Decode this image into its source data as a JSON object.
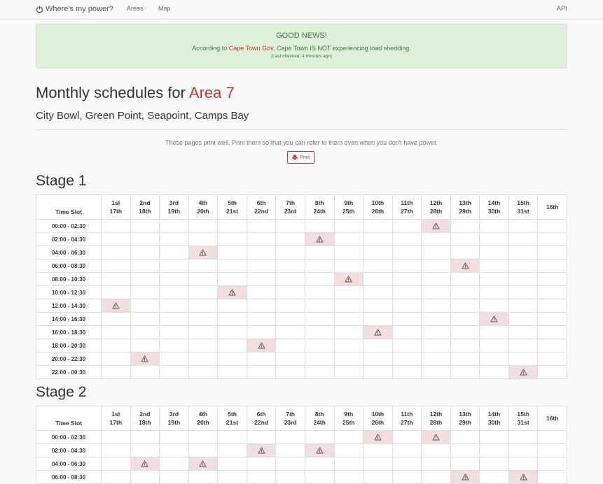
{
  "nav": {
    "brand": "Where's my power?",
    "links": [
      "Areas",
      "Map"
    ],
    "api": "API"
  },
  "alert": {
    "title": "GOOD NEWS!",
    "prefix": "According to ",
    "source": "Cape Town Gov",
    "suffix": ", Cape Town IS NOT experiencing load shedding.",
    "checked": "(Last checked: 4 minutes ago)"
  },
  "page": {
    "title_prefix": "Monthly schedules for ",
    "area": "Area 7",
    "subtitle": "City Bowl, Green Point, Seapoint, Camps Bay",
    "print_note": "These pages print well. Print them so that you can refer to them even when you don't have power.",
    "print_label": "Print"
  },
  "table": {
    "time_slot_header": "Time Slot",
    "day_headers": [
      [
        "1st",
        "17th"
      ],
      [
        "2nd",
        "18th"
      ],
      [
        "3rd",
        "19th"
      ],
      [
        "4th",
        "20th"
      ],
      [
        "5th",
        "21st"
      ],
      [
        "6th",
        "22nd"
      ],
      [
        "7th",
        "23rd"
      ],
      [
        "8th",
        "24th"
      ],
      [
        "9th",
        "25th"
      ],
      [
        "10th",
        "26th"
      ],
      [
        "11th",
        "27th"
      ],
      [
        "12th",
        "28th"
      ],
      [
        "13th",
        "29th"
      ],
      [
        "14th",
        "30th"
      ],
      [
        "15th",
        "31st"
      ],
      [
        "16th",
        ""
      ]
    ],
    "slots": [
      "00:00 - 02:30",
      "02:00 - 04:30",
      "04:00 - 06:30",
      "06:00 - 08:30",
      "08:00 - 10:30",
      "10:00 - 12:30",
      "12:00 - 14:30",
      "14:00 - 16:30",
      "16:00 - 18:30",
      "18:00 - 20:30",
      "20:00 - 22:30",
      "22:00 - 00:30"
    ]
  },
  "stages": [
    {
      "title": "Stage 1",
      "visible_rows": 12,
      "shedding": [
        [
          11
        ],
        [
          7
        ],
        [
          3
        ],
        [
          12
        ],
        [
          8
        ],
        [
          4
        ],
        [
          0
        ],
        [
          13
        ],
        [
          9
        ],
        [
          5
        ],
        [
          1
        ],
        [
          14
        ]
      ]
    },
    {
      "title": "Stage 2",
      "visible_rows": 4,
      "shedding": [
        [
          9,
          11
        ],
        [
          5,
          7
        ],
        [
          1,
          3
        ],
        [
          12,
          14
        ]
      ]
    }
  ],
  "colors": {
    "shedding_cell": "#f2dede",
    "alert_bg": "#dff0d8",
    "area_accent": "#c0392b"
  }
}
